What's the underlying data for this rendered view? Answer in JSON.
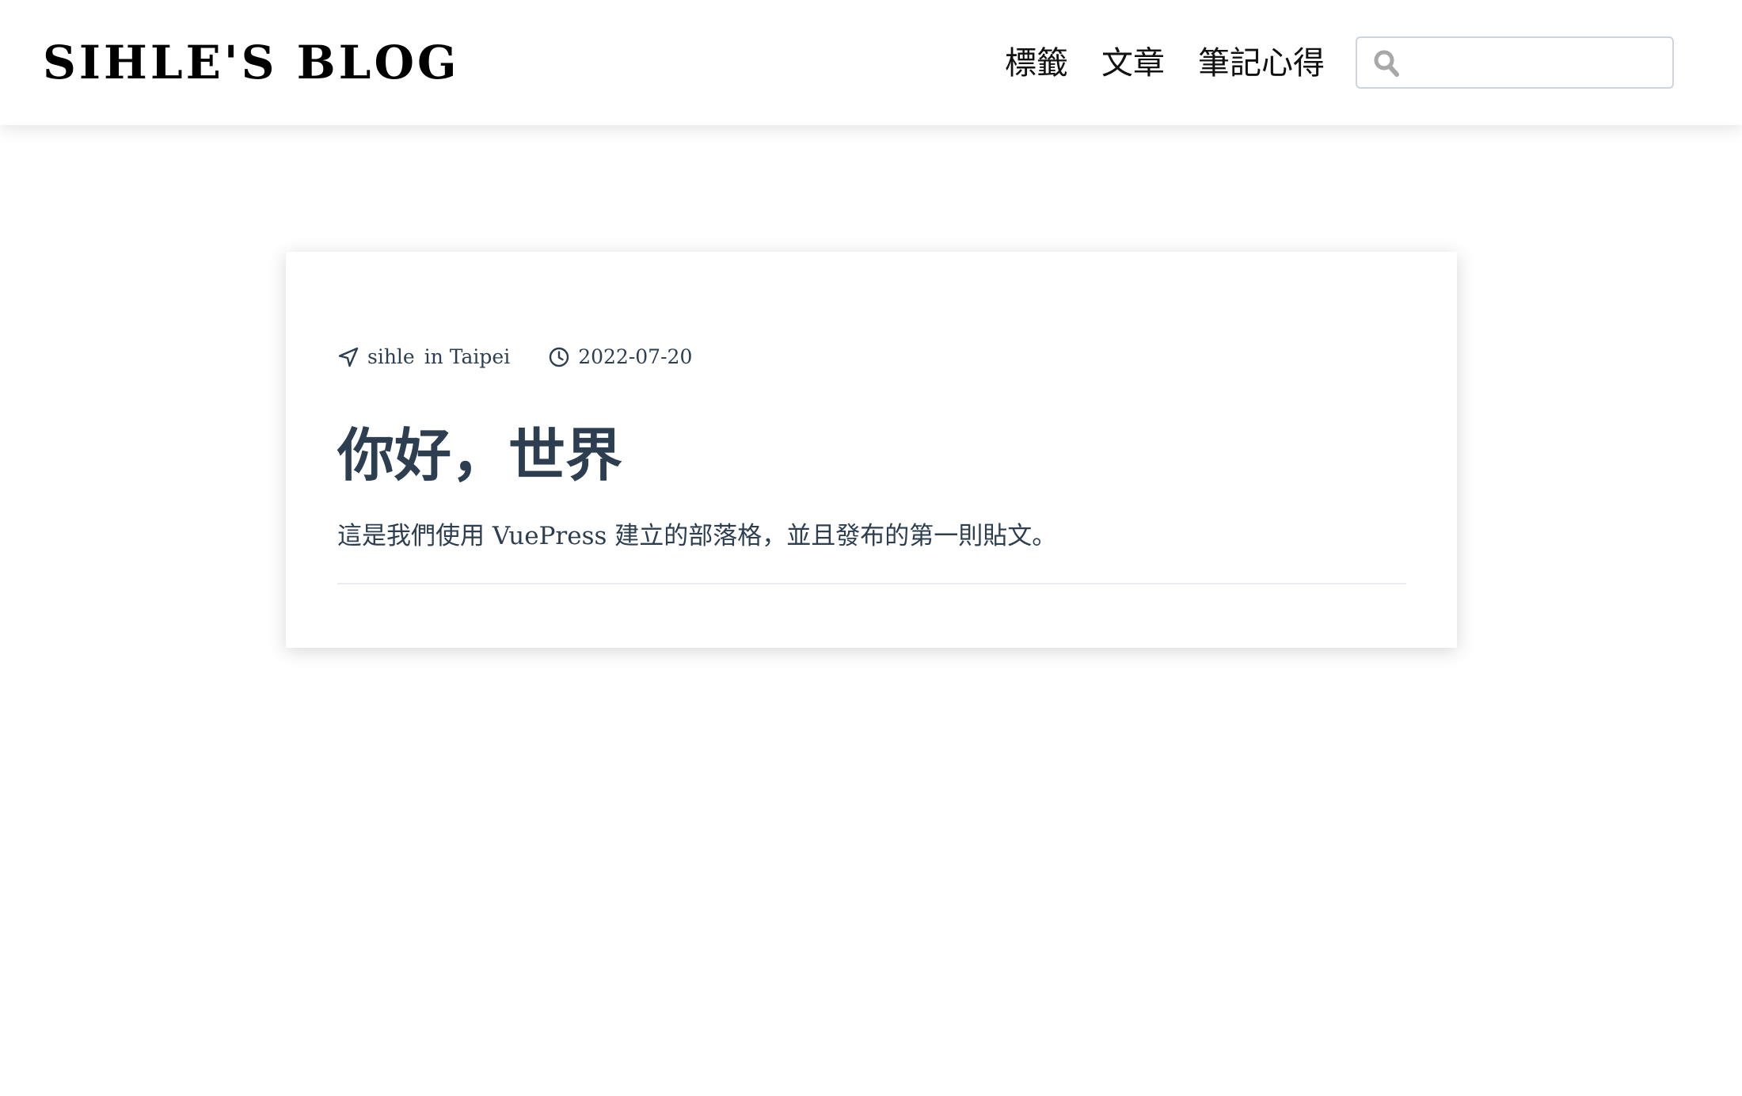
{
  "site": {
    "title": "SIHLE'S BLOG"
  },
  "nav": {
    "items": [
      {
        "label": "標籤"
      },
      {
        "label": "文章"
      },
      {
        "label": "筆記心得"
      }
    ]
  },
  "search": {
    "icon": "search-icon",
    "placeholder": "",
    "value": ""
  },
  "post": {
    "author": "sihle",
    "location": "in Taipei",
    "author_icon": "navigation-arrow-icon",
    "date": "2022-07-20",
    "date_icon": "clock-icon",
    "title": "你好，世界",
    "excerpt": "這是我們使用 VuePress 建立的部落格，並且發布的第一則貼文。"
  }
}
